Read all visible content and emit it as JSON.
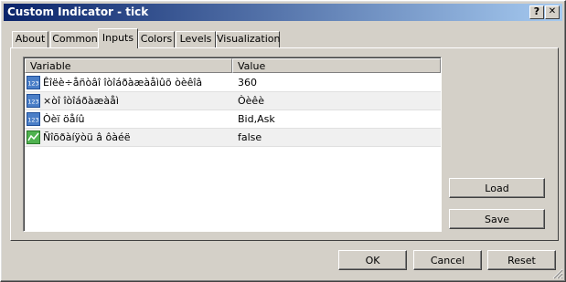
{
  "window": {
    "title": "Custom Indicator - tick",
    "help_label": "?",
    "close_label": "✕"
  },
  "tabs": [
    "About",
    "Common",
    "Inputs",
    "Colors",
    "Levels",
    "Visualization"
  ],
  "active_tab": "Inputs",
  "table": {
    "headers": {
      "variable": "Variable",
      "value": "Value"
    },
    "rows": [
      {
        "icon": "integer-icon",
        "variable": "Êîëè÷åñòâî îòîáðàæàåìûõ òèêîâ",
        "value": "360"
      },
      {
        "icon": "integer-icon",
        "variable": "×òî îòîáðàæàåì",
        "value": "Òèêè"
      },
      {
        "icon": "integer-icon",
        "variable": "Òèï öåíû",
        "value": "Bid,Ask"
      },
      {
        "icon": "boolean-icon",
        "variable": "Ñîõðàíÿòü â ôàéë",
        "value": "false"
      }
    ]
  },
  "side_buttons": {
    "load": "Load",
    "save": "Save"
  },
  "footer": {
    "ok": "OK",
    "cancel": "Cancel",
    "reset": "Reset"
  },
  "colors": {
    "title_start": "#0a246a",
    "title_end": "#a6caf0",
    "face": "#d4d0c8"
  }
}
